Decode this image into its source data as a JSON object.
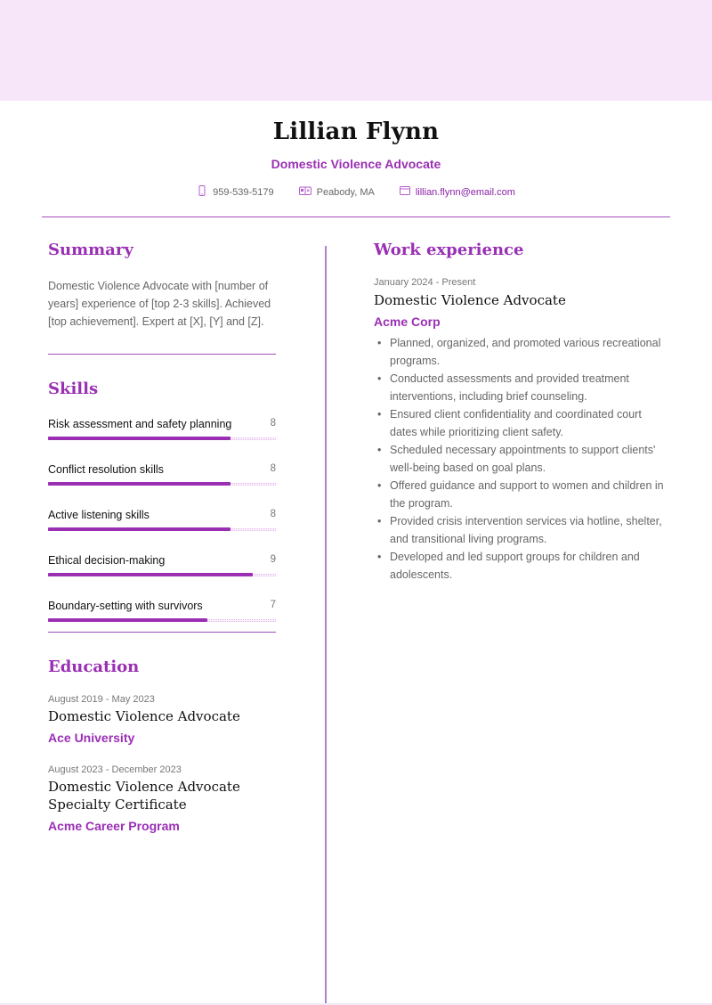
{
  "header": {
    "name": "Lillian Flynn",
    "title": "Domestic Violence Advocate",
    "contacts": [
      {
        "icon": "phone-icon",
        "text": "959-539-5179"
      },
      {
        "icon": "location-icon",
        "text": "Peabody, MA"
      },
      {
        "icon": "email-icon",
        "text": "lillian.flynn@email.com"
      }
    ]
  },
  "colors": {
    "accent": "#9a2fb4",
    "banner": "#f7e5f9",
    "divider": "#a24fbb"
  },
  "summary": {
    "heading": "Summary",
    "text": "Domestic Violence Advocate with [number of years] experience of [top 2-3 skills]. Achieved [top achievement]. Expert at [X], [Y] and [Z]."
  },
  "skills": {
    "heading": "Skills",
    "scale_max": 10,
    "items": [
      {
        "name": "Risk assessment and safety planning",
        "value": 8
      },
      {
        "name": "Conflict resolution skills",
        "value": 8
      },
      {
        "name": "Active listening skills",
        "value": 8
      },
      {
        "name": "Ethical decision-making",
        "value": 9
      },
      {
        "name": "Boundary-setting with survivors",
        "value": 7
      }
    ]
  },
  "education": {
    "heading": "Education",
    "items": [
      {
        "date": "August 2019 - May 2023",
        "degree": "Domestic Violence Advocate",
        "school": "Ace University"
      },
      {
        "date": "August 2023 - December 2023",
        "degree": "Domestic Violence Advocate Specialty Certificate",
        "school": "Acme Career Program"
      }
    ]
  },
  "work": {
    "heading": "Work experience",
    "items": [
      {
        "date": "January 2024 - Present",
        "role": "Domestic Violence Advocate",
        "company": "Acme Corp",
        "bullets": [
          "Planned, organized, and promoted various recreational programs.",
          "Conducted assessments and provided treatment interventions, including brief counseling.",
          "Ensured client confidentiality and coordinated court dates while prioritizing client safety.",
          "Scheduled necessary appointments to support clients' well-being based on goal plans.",
          "Offered guidance and support to women and children in the program.",
          "Provided crisis intervention services via hotline, shelter, and transitional living programs.",
          "Developed and led support groups for children and adolescents."
        ]
      }
    ]
  }
}
